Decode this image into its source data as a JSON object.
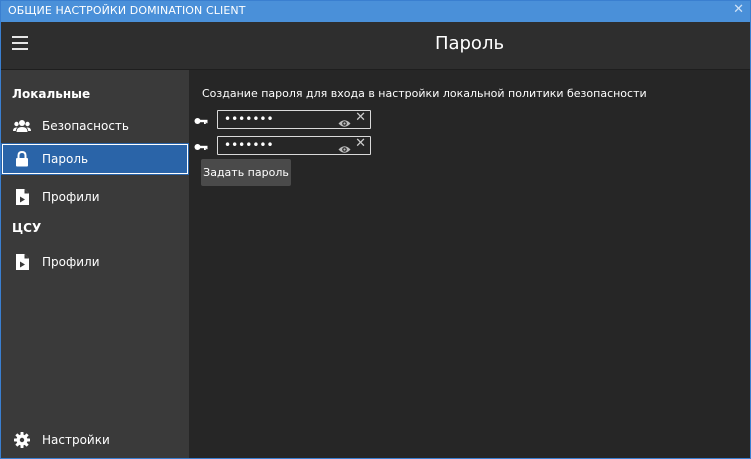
{
  "window": {
    "title": "ОБЩИЕ НАСТРОЙКИ DOMINATION CLIENT",
    "close_glyph": "✕"
  },
  "header": {
    "menu_icon": "hamburger-icon",
    "page_title": "Пароль"
  },
  "sidebar": {
    "groups": [
      {
        "label": "Локальные",
        "items": [
          {
            "label": "Безопасность",
            "icon": "users-icon",
            "active": false
          },
          {
            "label": "Пароль",
            "icon": "lock-icon",
            "active": true
          },
          {
            "label": "Профили",
            "icon": "file-icon",
            "active": false
          }
        ]
      },
      {
        "label": "ЦСУ",
        "items": [
          {
            "label": "Профили",
            "icon": "file-icon",
            "active": false
          }
        ]
      }
    ],
    "footer_item": {
      "label": "Настройки",
      "icon": "gear-icon"
    }
  },
  "main": {
    "description": "Создание пароля для входа в настройки локальной политики безопасности",
    "password_fields": [
      {
        "masked_value": "•••••••",
        "icon": "key-icon"
      },
      {
        "masked_value": "•••••••",
        "icon": "key-icon"
      }
    ],
    "set_password_label": "Задать пароль"
  },
  "colors": {
    "titlebar": "#4a90d9",
    "sidebar_bg": "#3a3a3a",
    "content_bg": "#262626",
    "active_item": "#2a64a8",
    "button_bg": "#4a4a4a"
  }
}
